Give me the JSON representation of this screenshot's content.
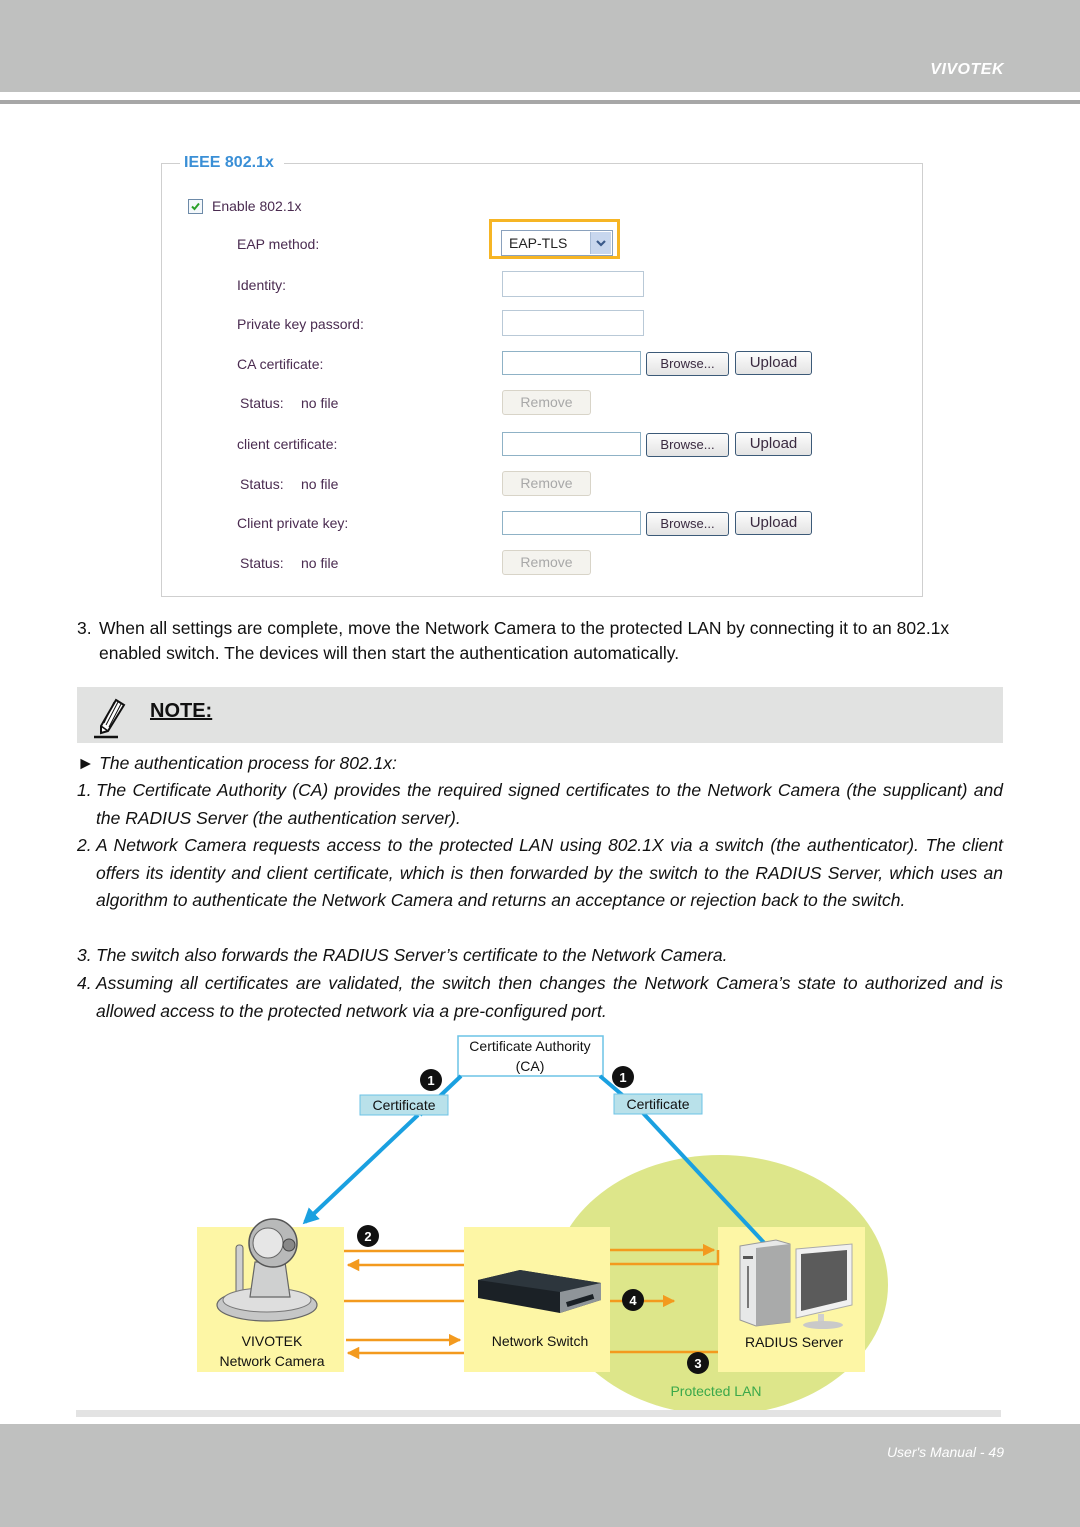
{
  "header": {
    "brand": "VIVOTEK"
  },
  "panel": {
    "legend": "IEEE 802.1x",
    "enable": {
      "label": "Enable 802.1x",
      "checked": true
    },
    "eap_method": {
      "label": "EAP method:",
      "value": "EAP-TLS"
    },
    "identity": {
      "label": "Identity:",
      "value": ""
    },
    "private_key_password": {
      "label": "Private key passord:",
      "value": ""
    },
    "ca_certificate": {
      "label": "CA certificate:",
      "browse": "Browse...",
      "upload": "Upload",
      "status": "Status:",
      "status_value": "no file",
      "remove": "Remove"
    },
    "client_certificate": {
      "label": "client certificate:",
      "browse": "Browse...",
      "upload": "Upload",
      "status": "Status:",
      "status_value": "no file",
      "remove": "Remove"
    },
    "client_private_key": {
      "label": "Client private key:",
      "browse": "Browse...",
      "upload": "Upload",
      "status": "Status:",
      "status_value": "no file",
      "remove": "Remove"
    }
  },
  "step3": {
    "number": "3.",
    "text": "When all settings are complete, move the Network Camera to the protected LAN by connecting it to an 802.1x enabled switch. The devices will then start the authentication automatically."
  },
  "note": {
    "title": "NOTE:",
    "intro": "► The authentication process for 802.1x:",
    "items": [
      {
        "n": "1.",
        "text": "The Certificate Authority (CA) provides the required signed certificates to the Network Camera (the supplicant) and the RADIUS Server (the authentication server)."
      },
      {
        "n": "2.",
        "text": "A Network Camera requests access to the protected LAN using 802.1X via a switch (the authenticator). The client offers its identity and client certificate, which is then forwarded by the switch to the RADIUS Server, which uses an algorithm to authenticate the Network Camera and returns an acceptance or rejection back to the switch."
      },
      {
        "n": "3.",
        "text": "The switch also forwards the RADIUS Server’s certificate to the Network Camera."
      },
      {
        "n": "4.",
        "text": "Assuming all certificates are validated, the switch then changes the Network Camera’s state to authorized and is allowed access to the protected network via a pre-configured port."
      }
    ]
  },
  "diagram": {
    "ca_line1": "Certificate Authority",
    "ca_line2": "(CA)",
    "cert_left": "Certificate",
    "cert_right": "Certificate",
    "camera_line1": "VIVOTEK",
    "camera_line2": "Network Camera",
    "switch_label": "Network Switch",
    "server_label": "RADIUS Server",
    "lan_label": "Protected LAN",
    "badges": [
      "1",
      "1",
      "2",
      "3",
      "4"
    ],
    "colors": {
      "arrow_blue": "#1aa0e0",
      "arrow_orange": "#f39a1e",
      "lan_green": "#dde68a",
      "box_yellow": "#fdf6a5",
      "cert_fill": "#b9e1ea",
      "lan_text": "#3aa84a"
    }
  },
  "footer": {
    "page_label": "User's Manual - 49"
  }
}
